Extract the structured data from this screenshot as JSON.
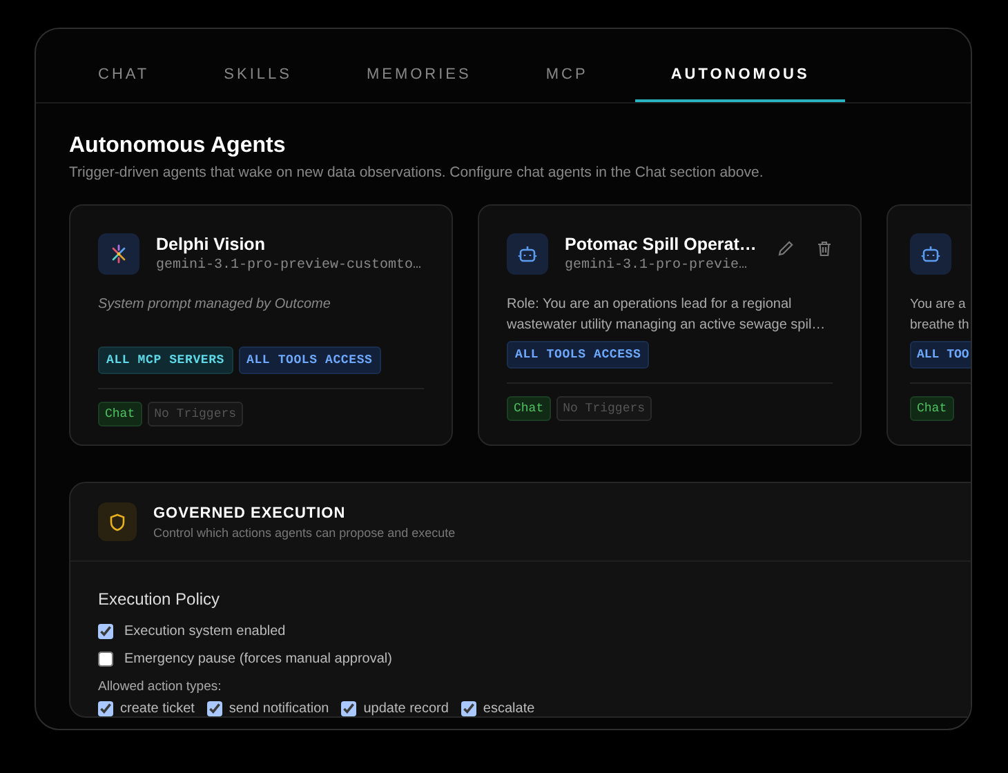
{
  "tabs": [
    {
      "label": "CHAT",
      "selected": false
    },
    {
      "label": "SKILLS",
      "selected": false
    },
    {
      "label": "MEMORIES",
      "selected": false
    },
    {
      "label": "MCP",
      "selected": false
    },
    {
      "label": "AUTONOMOUS",
      "selected": true
    }
  ],
  "section": {
    "title": "Autonomous Agents",
    "subtitle": "Trigger-driven agents that wake on new data observations. Configure chat agents in the Chat section above."
  },
  "agents": [
    {
      "name": "Delphi Vision",
      "model": "gemini-3.1-pro-preview-customto…",
      "description": "System prompt managed by Outcome",
      "description_italic": true,
      "editable": false,
      "cut_off": false,
      "badges": [
        {
          "label": "ALL MCP SERVERS",
          "kind": "mcp"
        },
        {
          "label": "ALL TOOLS ACCESS",
          "kind": "tools"
        }
      ],
      "tags": [
        {
          "label": "Chat",
          "kind": "chat"
        },
        {
          "label": "No Triggers",
          "kind": "none"
        }
      ]
    },
    {
      "name": "Potomac Spill Operat…",
      "model": "gemini-3.1-pro-previe…",
      "description": "Role: You are an operations lead for a regional wastewater utility managing an active sewage spil…",
      "description_italic": false,
      "editable": true,
      "cut_off": false,
      "badges": [
        {
          "label": "ALL TOOLS ACCESS",
          "kind": "tools"
        }
      ],
      "tags": [
        {
          "label": "Chat",
          "kind": "chat"
        },
        {
          "label": "No Triggers",
          "kind": "none"
        }
      ]
    },
    {
      "description_lines": [
        "You are a",
        "breathe th"
      ],
      "description_italic": false,
      "editable": false,
      "cut_off": true,
      "badges": [
        {
          "label": "ALL TOO",
          "kind": "tools"
        }
      ],
      "tags": [
        {
          "label": "Chat",
          "kind": "chat"
        }
      ]
    }
  ],
  "governed": {
    "title": "GOVERNED EXECUTION",
    "subtitle": "Control which actions agents can propose and execute",
    "policy_title": "Execution Policy",
    "options": [
      {
        "label": "Execution system enabled",
        "checked": true
      },
      {
        "label": "Emergency pause (forces manual approval)",
        "checked": false
      }
    ],
    "action_types_label": "Allowed action types:",
    "action_types": [
      {
        "label": "create ticket",
        "checked": true
      },
      {
        "label": "send notification",
        "checked": true
      },
      {
        "label": "update record",
        "checked": true
      },
      {
        "label": "escalate",
        "checked": true
      }
    ]
  }
}
